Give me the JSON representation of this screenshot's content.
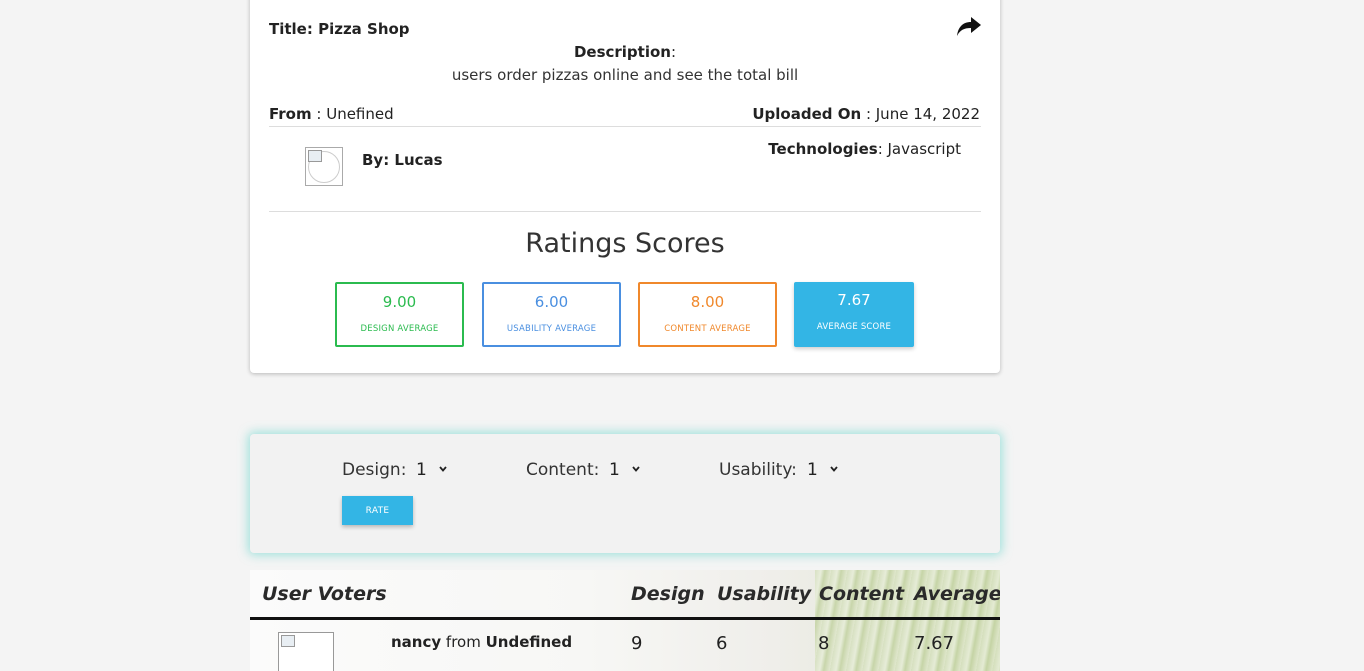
{
  "project": {
    "title": "Title: Pizza Shop",
    "description_label": "Description",
    "description_colon": ":",
    "description": "users order pizzas online and see the total bill",
    "from_label": "From",
    "from_value": " : Unefined",
    "uploaded_label": "Uploaded On",
    "uploaded_value": " : June 14, 2022",
    "author": "By: Lucas",
    "technologies_label": "Technologies",
    "technologies_value": ": Javascript"
  },
  "ratings": {
    "title": "Ratings Scores",
    "design": {
      "value": "9.00",
      "label": "DESIGN AVERAGE",
      "color": "#2bbb4f"
    },
    "usability": {
      "value": "6.00",
      "label": "USABILITY AVERAGE",
      "color": "#4a8fe0"
    },
    "content": {
      "value": "8.00",
      "label": "CONTENT AVERAGE",
      "color": "#f0882b"
    },
    "average": {
      "value": "7.67",
      "label": "AVERAGE SCORE",
      "color": "#33b5e5"
    }
  },
  "rate_form": {
    "design_label": "Design:",
    "design_value": "1",
    "content_label": "Content:",
    "content_value": "1",
    "usability_label": "Usability:",
    "usability_value": "1",
    "rate_button": "RATE"
  },
  "voters_table": {
    "headers": [
      "User Voters",
      "Design",
      "Usability",
      "Content",
      "Average"
    ],
    "rows": [
      {
        "name": "nancy",
        "from_word": " from ",
        "location": "Undefined",
        "design": "9",
        "usability": "6",
        "content": "8",
        "average": "7.67"
      }
    ]
  },
  "icons": {
    "share": "share-arrow-icon",
    "dropdown": "chevron-down-icon"
  }
}
